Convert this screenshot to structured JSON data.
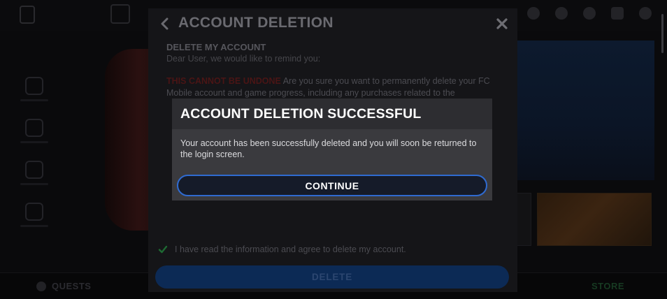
{
  "panel": {
    "title": "ACCOUNT DELETION",
    "section_title": "DELETE MY ACCOUNT",
    "greeting": "Dear User, we would like to remind you:",
    "warning_intro": "THIS CANNOT BE UNDONE",
    "warning_text": "Are you sure you want to permanently delete your FC Mobile account and game progress, including any purchases related to the",
    "agree_text": "I have read the information and agree to delete my account.",
    "delete_label": "DELETE"
  },
  "dialog": {
    "title": "ACCOUNT DELETION SUCCESSFUL",
    "body": "Your account has been successfully deleted and you will soon be returned to the login screen.",
    "continue_label": "CONTINUE"
  },
  "background": {
    "quests_label": "QUESTS",
    "store_label": "STORE"
  },
  "colors": {
    "accent_blue": "#2f6bd1",
    "delete_button": "#0c2a55",
    "dialog_bg": "#3a3a3e",
    "dialog_header": "#2d2d31",
    "check_green": "#1e6a33"
  },
  "icons": {
    "back": "chevron-left-icon",
    "close": "close-icon",
    "agree": "checkmark-icon"
  }
}
